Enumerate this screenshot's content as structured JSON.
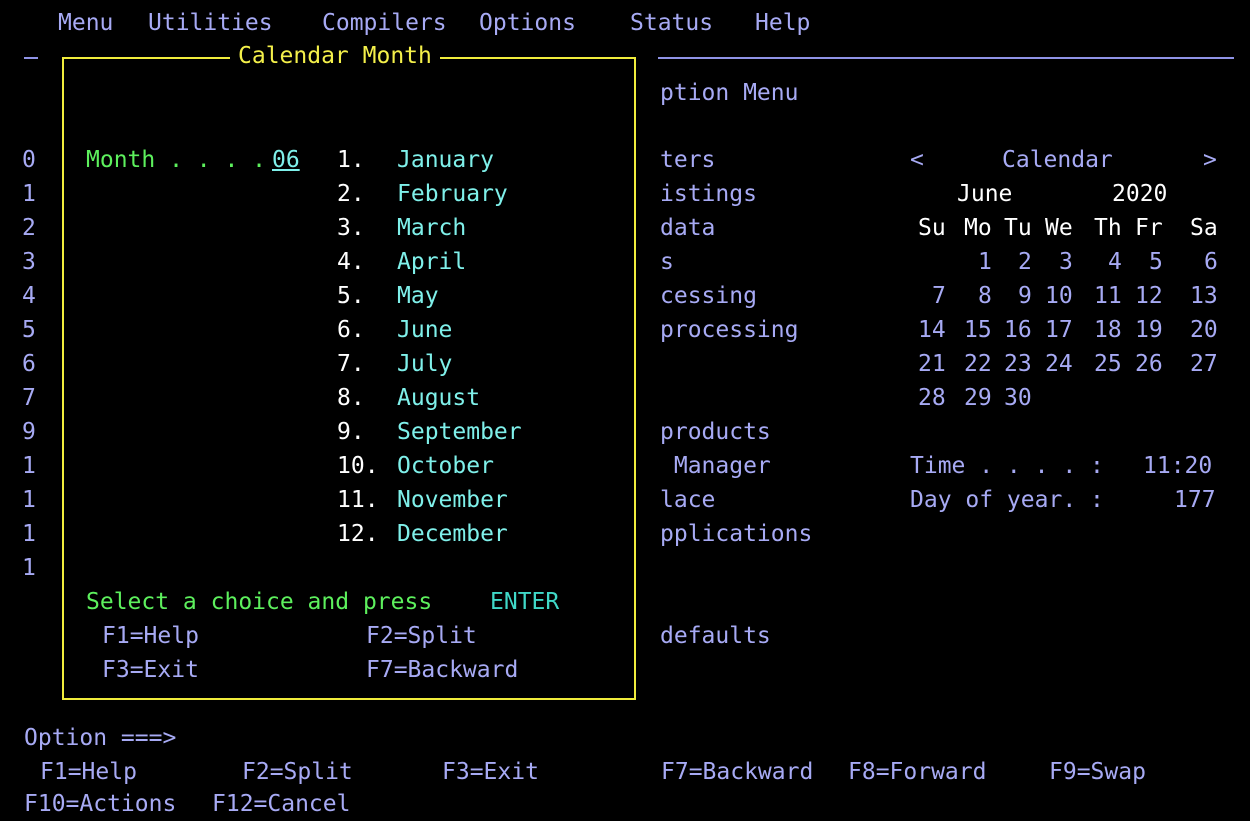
{
  "menubar": {
    "items": [
      "Menu",
      "Utilities",
      "Compilers",
      "Options",
      "Status",
      "Help"
    ]
  },
  "background_panel": {
    "left_digits": [
      "0",
      "1",
      "2",
      "3",
      "4",
      "5",
      "6",
      "7",
      "9",
      "1",
      "1",
      "1",
      "1"
    ],
    "option_menu_fragment": "ption Menu",
    "menu_fragments": [
      "ters",
      "istings",
      "data",
      "s",
      "cessing",
      "processing",
      "",
      "",
      "products",
      " Manager",
      "lace",
      "pplications",
      "",
      "",
      "defaults"
    ]
  },
  "calendar": {
    "prev": "<",
    "title": "Calendar",
    "next": ">",
    "month": "June",
    "year": "2020",
    "weekdays": [
      "Su",
      "Mo",
      "Tu",
      "We",
      "Th",
      "Fr",
      "Sa"
    ],
    "weeks": [
      [
        "",
        "1",
        "2",
        "3",
        "4",
        "5",
        "6"
      ],
      [
        "7",
        "8",
        "9",
        "10",
        "11",
        "12",
        "13"
      ],
      [
        "14",
        "15",
        "16",
        "17",
        "18",
        "19",
        "20"
      ],
      [
        "21",
        "22",
        "23",
        "24",
        "25",
        "26",
        "27"
      ],
      [
        "28",
        "29",
        "30",
        "",
        "",
        "",
        ""
      ]
    ],
    "time_label": "Time . . . . :",
    "time_value": "11:20",
    "doy_label": "Day of year. :",
    "doy_value": "177"
  },
  "popup": {
    "title": "Calendar Month",
    "month_label": "Month . . . .",
    "month_value": "06",
    "choices": [
      {
        "num": "1.",
        "name": "January"
      },
      {
        "num": "2.",
        "name": "February"
      },
      {
        "num": "3.",
        "name": "March"
      },
      {
        "num": "4.",
        "name": "April"
      },
      {
        "num": "5.",
        "name": "May"
      },
      {
        "num": "6.",
        "name": "June"
      },
      {
        "num": "7.",
        "name": "July"
      },
      {
        "num": "8.",
        "name": "August"
      },
      {
        "num": "9.",
        "name": "September"
      },
      {
        "num": "10.",
        "name": "October"
      },
      {
        "num": "11.",
        "name": "November"
      },
      {
        "num": "12.",
        "name": "December"
      }
    ],
    "instruction": "Select a choice and press",
    "instruction_key": "ENTER",
    "keys": [
      "F1=Help",
      "F2=Split",
      "F3=Exit",
      "F7=Backward"
    ]
  },
  "command": {
    "prompt": "Option ===>"
  },
  "fkeys": {
    "row1": [
      "F1=Help",
      "F2=Split",
      "F3=Exit",
      "F7=Backward",
      "F8=Forward",
      "F9=Swap"
    ],
    "row2": [
      "F10=Actions",
      "F12=Cancel"
    ]
  }
}
